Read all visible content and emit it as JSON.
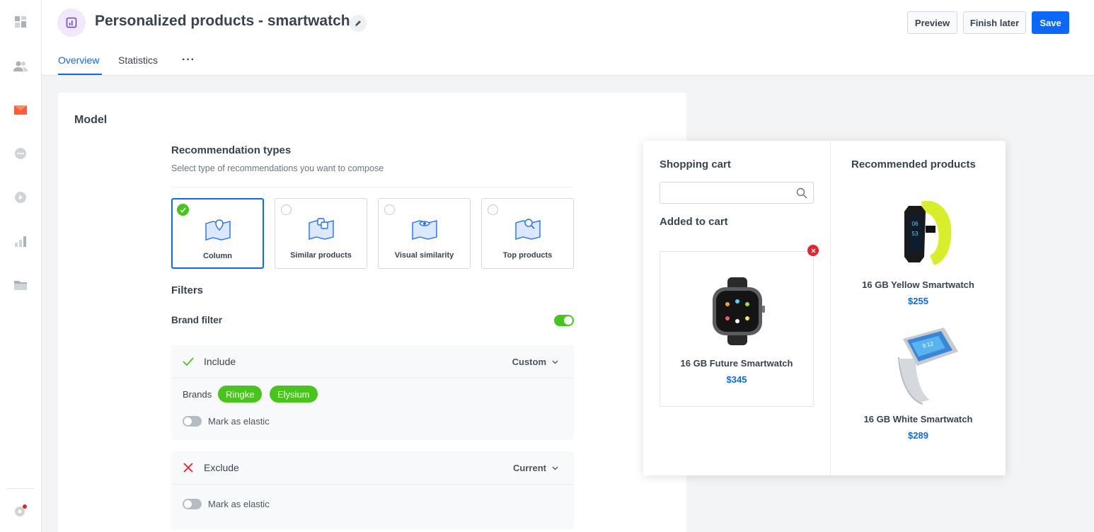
{
  "header": {
    "title": "Personalized products - smartwatch",
    "preview_label": "Preview",
    "finish_later_label": "Finish later",
    "save_label": "Save",
    "tabs": [
      {
        "label": "Overview",
        "active": true
      },
      {
        "label": "Statistics",
        "active": false
      }
    ],
    "more_label": "···"
  },
  "sidebar": {
    "icons": [
      "dashboard-icon",
      "people-icon",
      "campaign-icon",
      "chat-icon",
      "play-icon",
      "analytics-icon",
      "folder-icon",
      "settings-icon"
    ]
  },
  "model": {
    "title": "Model",
    "recommendation_types": {
      "title": "Recommendation types",
      "subtitle": "Select type of recommendations you want to compose",
      "options": [
        {
          "label": "Column",
          "selected": true
        },
        {
          "label": "Similar products",
          "selected": false
        },
        {
          "label": "Visual similarity",
          "selected": false
        },
        {
          "label": "Top products",
          "selected": false
        }
      ]
    },
    "filters": {
      "title": "Filters",
      "brand_filter_label": "Brand filter",
      "brand_filter_enabled": true,
      "include": {
        "title": "Include",
        "select_value": "Custom",
        "brands_label": "Brands",
        "brands": [
          "Ringke",
          "Elysium"
        ],
        "elastic_label": "Mark as elastic"
      },
      "exclude": {
        "title": "Exclude",
        "select_value": "Current",
        "elastic_label": "Mark as elastic"
      }
    }
  },
  "preview": {
    "shopping_cart_title": "Shopping cart",
    "search_placeholder": "",
    "added_to_cart_title": "Added to cart",
    "cart_item": {
      "name": "16 GB Future Smartwatch",
      "price": "$345"
    },
    "recommended_title": "Recommended products",
    "recommended": [
      {
        "name": "16 GB Yellow Smartwatch",
        "price": "$255"
      },
      {
        "name": "16 GB White Smartwatch",
        "price": "$289"
      }
    ]
  },
  "colors": {
    "accent": "#0b68ff",
    "success": "#47c51a",
    "danger": "#e5252a",
    "brand_badge": "#7c3aed"
  }
}
